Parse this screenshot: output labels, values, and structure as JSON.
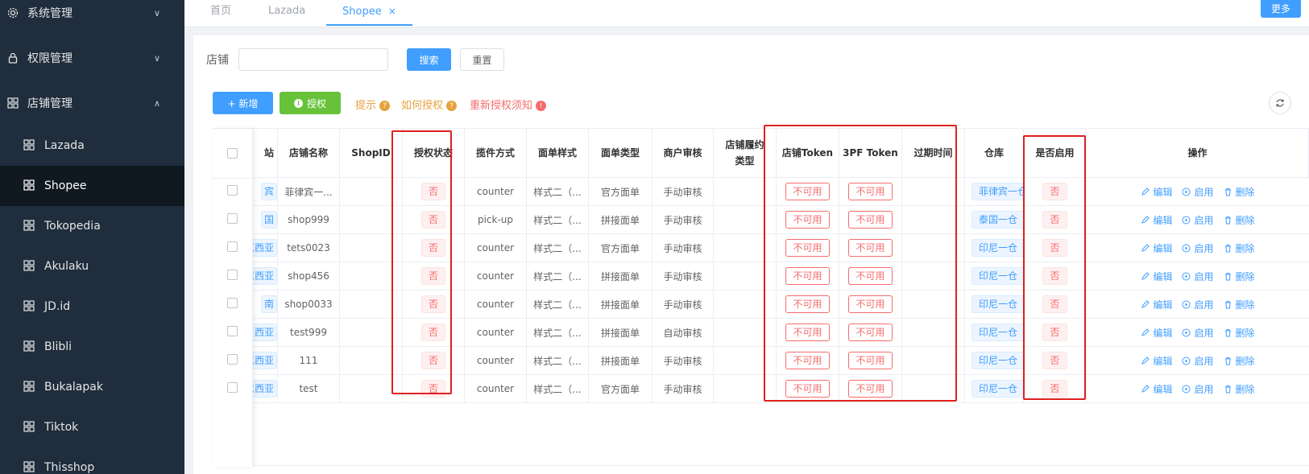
{
  "sidebar": {
    "groups": [
      {
        "label": "系统管理",
        "icon": "gear-icon"
      },
      {
        "label": "权限管理",
        "icon": "lock-icon"
      },
      {
        "label": "店铺管理",
        "icon": "grid-icon"
      }
    ],
    "items": [
      {
        "label": "Lazada"
      },
      {
        "label": "Shopee",
        "active": true
      },
      {
        "label": "Tokopedia"
      },
      {
        "label": "Akulaku"
      },
      {
        "label": "JD.id"
      },
      {
        "label": "Blibli"
      },
      {
        "label": "Bukalapak"
      },
      {
        "label": "Tiktok"
      },
      {
        "label": "Thisshop"
      }
    ]
  },
  "tabs": [
    {
      "label": "首页"
    },
    {
      "label": "Lazada"
    },
    {
      "label": "Shopee",
      "active": true,
      "close": "×"
    }
  ],
  "more_label": "更多",
  "search": {
    "label": "店铺",
    "value": "",
    "search_btn": "搜索",
    "reset_btn": "重置"
  },
  "toolbar": {
    "add_btn": "+ 新增",
    "auth_btn": "授权",
    "hint1": "提示",
    "hint2": "如何授权",
    "hint3": "重新授权须知"
  },
  "table": {
    "headers": [
      "站",
      "店铺名称",
      "ShopID",
      "授权状态",
      "揽件方式",
      "面单样式",
      "面单类型",
      "商户审核",
      "店铺履约类型",
      "店铺Token",
      "3PF Token",
      "过期时间",
      "仓库",
      "是否启用",
      "操作"
    ],
    "rows": [
      {
        "site": "宾",
        "name": "菲律宾一...",
        "shopid": "",
        "auth": "否",
        "pickup": "counter",
        "style": "样式二（...",
        "type": "官方面单",
        "review": "手动审核",
        "fulfill": "",
        "token": "不可用",
        "pf_token": "不可用",
        "expire": "",
        "warehouse": "菲律宾一仓",
        "enabled": "否"
      },
      {
        "site": "国",
        "name": "shop999",
        "shopid": "",
        "auth": "否",
        "pickup": "pick-up",
        "style": "样式二（...",
        "type": "拼接面单",
        "review": "手动审核",
        "fulfill": "",
        "token": "不可用",
        "pf_token": "不可用",
        "expire": "",
        "warehouse": "泰国一仓",
        "enabled": "否"
      },
      {
        "site": "尼西亚",
        "name": "tets0023",
        "shopid": "",
        "auth": "否",
        "pickup": "counter",
        "style": "样式二（...",
        "type": "官方面单",
        "review": "手动审核",
        "fulfill": "",
        "token": "不可用",
        "pf_token": "不可用",
        "expire": "",
        "warehouse": "印尼一仓",
        "enabled": "否"
      },
      {
        "site": "尼西亚",
        "name": "shop456",
        "shopid": "",
        "auth": "否",
        "pickup": "counter",
        "style": "样式二（...",
        "type": "拼接面单",
        "review": "手动审核",
        "fulfill": "",
        "token": "不可用",
        "pf_token": "不可用",
        "expire": "",
        "warehouse": "印尼一仓",
        "enabled": "否"
      },
      {
        "site": "南",
        "name": "shop0033",
        "shopid": "",
        "auth": "否",
        "pickup": "counter",
        "style": "样式二（...",
        "type": "拼接面单",
        "review": "手动审核",
        "fulfill": "",
        "token": "不可用",
        "pf_token": "不可用",
        "expire": "",
        "warehouse": "印尼一仓",
        "enabled": "否"
      },
      {
        "site": "西亚",
        "name": "test999",
        "shopid": "",
        "auth": "否",
        "pickup": "counter",
        "style": "样式二（...",
        "type": "拼接面单",
        "review": "自动审核",
        "fulfill": "",
        "token": "不可用",
        "pf_token": "不可用",
        "expire": "",
        "warehouse": "印尼一仓",
        "enabled": "否"
      },
      {
        "site": "尼西亚",
        "name": "111",
        "shopid": "",
        "auth": "否",
        "pickup": "counter",
        "style": "样式二（...",
        "type": "拼接面单",
        "review": "手动审核",
        "fulfill": "",
        "token": "不可用",
        "pf_token": "不可用",
        "expire": "",
        "warehouse": "印尼一仓",
        "enabled": "否"
      },
      {
        "site": "尼西亚",
        "name": "test",
        "shopid": "",
        "auth": "否",
        "pickup": "counter",
        "style": "样式二（...",
        "type": "官方面单",
        "review": "手动审核",
        "fulfill": "",
        "token": "不可用",
        "pf_token": "不可用",
        "expire": "",
        "warehouse": "印尼一仓",
        "enabled": "否"
      }
    ],
    "ops": {
      "edit": "编辑",
      "enable": "启用",
      "delete": "删除"
    }
  }
}
